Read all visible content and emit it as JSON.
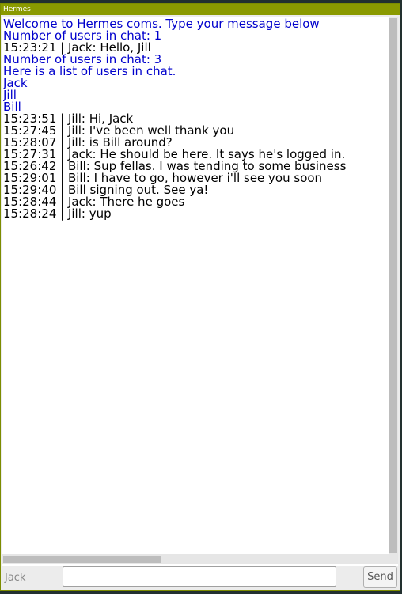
{
  "window": {
    "title": "Hermes"
  },
  "chat": {
    "lines": [
      {
        "text": "Welcome to Hermes coms. Type your message below",
        "kind": "system"
      },
      {
        "text": "Number of users in chat: 1",
        "kind": "system"
      },
      {
        "text": "15:23:21 | Jack: Hello, Jill",
        "kind": "message"
      },
      {
        "text": "Number of users in chat: 3",
        "kind": "system"
      },
      {
        "text": "Here is a list of users in chat.",
        "kind": "system"
      },
      {
        "text": "Jack",
        "kind": "system"
      },
      {
        "text": "Jill",
        "kind": "system"
      },
      {
        "text": "Bill",
        "kind": "system"
      },
      {
        "text": "15:23:51 | Jill: Hi, Jack",
        "kind": "message"
      },
      {
        "text": "15:27:45 | Jill: I've been well thank you",
        "kind": "message"
      },
      {
        "text": "15:28:07 | Jill: is Bill around?",
        "kind": "message"
      },
      {
        "text": "15:27:31 | Jack: He should be here. It says he's logged in.",
        "kind": "message"
      },
      {
        "text": "15:26:42 | Bill: Sup fellas. I was tending to some business",
        "kind": "message"
      },
      {
        "text": "15:29:01 | Bill: I have to go, however i'll see you soon",
        "kind": "message"
      },
      {
        "text": "15:29:40 | Bill signing out. See ya!",
        "kind": "message"
      },
      {
        "text": "15:28:44 | Jack: There he goes",
        "kind": "message"
      },
      {
        "text": "15:28:24 | Jill: yup",
        "kind": "message"
      }
    ]
  },
  "input_bar": {
    "username": "Jack",
    "message_value": "",
    "send_label": "Send"
  },
  "colors": {
    "titlebar": "#8a9a00",
    "system_text": "#0000cc",
    "message_text": "#000000"
  }
}
